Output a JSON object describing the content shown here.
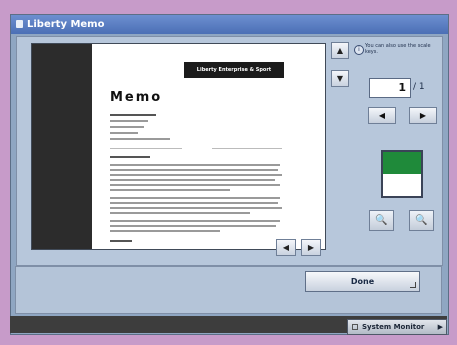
{
  "window": {
    "title": "Liberty Memo",
    "title_icon": "document-icon"
  },
  "preview": {
    "banner_text": "Liberty Enterprise & Sport",
    "doc_title": "Memo",
    "scroll_up_icon": "▲",
    "scroll_down_icon": "▼",
    "prev_icon": "◀",
    "next_icon": "▶"
  },
  "side": {
    "hint": "You can also use the scale keys.",
    "hint_icon": "info-icon",
    "current_page": "1",
    "total_pages": "/ 1",
    "prev_page_icon": "◀",
    "next_page_icon": "▶",
    "zoom_out_icon": "magnifier-minus-icon",
    "zoom_in_icon": "magnifier-plus-icon",
    "zoom_out_glyph": "🔍",
    "zoom_in_glyph": "🔍"
  },
  "footer": {
    "done_label": "Done",
    "system_monitor_label": "System Monitor",
    "system_monitor_arrow": "▶"
  },
  "colors": {
    "title_bar": "#4b6fb5",
    "background": "#c79bc9",
    "panel": "#b7c7db",
    "thumbnail_top": "#1f8a3a",
    "status_bar": "#3d3d3d"
  }
}
